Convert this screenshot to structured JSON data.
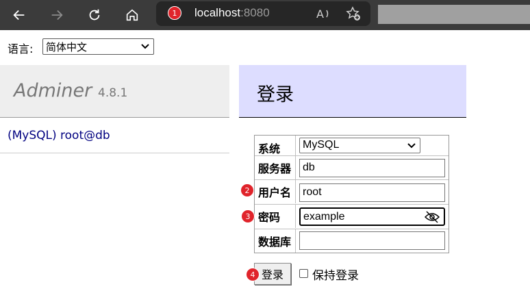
{
  "browser": {
    "url_host": "localhost",
    "url_port": ":8080",
    "icons": [
      "back-arrow-icon",
      "forward-arrow-icon",
      "refresh-icon",
      "home-icon",
      "read-aloud-icon",
      "add-favorite-icon"
    ]
  },
  "annotations": {
    "badge_1": "1",
    "badge_2": "2",
    "badge_3": "3",
    "badge_4": "4"
  },
  "language": {
    "label": "语言:",
    "selected": "简体中文"
  },
  "app": {
    "name": "Adminer",
    "version": "4.8.1",
    "connection": "(MySQL) root@db"
  },
  "login": {
    "title": "登录",
    "fields": {
      "system_label": "系统",
      "system_value": "MySQL",
      "server_label": "服务器",
      "server_value": "db",
      "username_label": "用户名",
      "username_value": "root",
      "password_label": "密码",
      "password_value": "example",
      "database_label": "数据库",
      "database_value": ""
    },
    "submit_label": "登录",
    "remember_label": "保持登录",
    "remember_checked": false
  },
  "colors": {
    "browser_bar": "#3b3b3b",
    "badge": "#e0242b",
    "menu_bg": "#eeeeee",
    "heading_bg": "#ddddff",
    "link": "#000080"
  }
}
